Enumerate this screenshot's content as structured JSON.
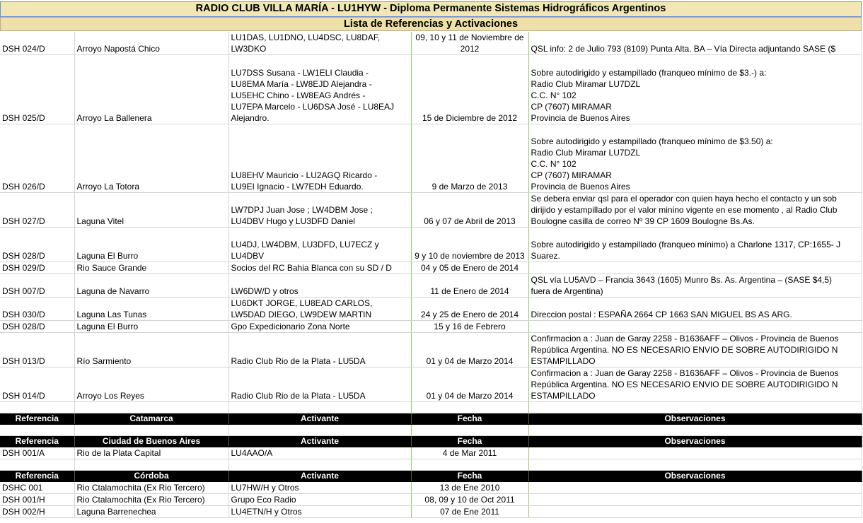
{
  "title": "RADIO CLUB VILLA MARÍA - LU1HYW - Diploma Permanente Sistemas Hidrográficos Argentinos",
  "subtitle": "Lista de Referencias y Activaciones",
  "rows_top": [
    {
      "ref": "DSH 024/D",
      "nombre": "Arroyo Napostá Chico",
      "act": [
        "LU1DAS, LU1DNO, LU4DSC, LU8DAF,",
        "LW3DKO"
      ],
      "fecha": "09, 10 y 11 de Noviembre de 2012",
      "obs": [
        "QSL info: 2 de Julio 793 (8109) Punta Alta. BA – Vía Directa adjuntando SASE ($"
      ]
    },
    {
      "ref": "DSH 025/D",
      "nombre": "Arroyo La Ballenera",
      "act": [
        "LU7DSS Susana - LW1ELI Claudia -",
        "LU8EMA María - LW8EJD Alejandra -",
        "LU5EHC Chino - LW8EAG Andrés -",
        "LU7EPA Marcelo - LU6DSA José - LU8EAJ",
        "Alejandro."
      ],
      "fecha": "15 de Diciembre de 2012",
      "obs": [
        "Sobre autodirigido y estampillado (franqueo mínimo de $3.-) a:",
        "Radio Club Miramar LU7DZL",
        "C.C. N° 102",
        "CP (7607) MIRAMAR",
        "Provincia de Buenos Aires"
      ]
    },
    {
      "ref": "DSH 026/D",
      "nombre": "Arroyo La Totora",
      "act": [
        "LU8EHV Mauricio - LU2AGQ Ricardo -",
        "LU9EI Ignacio - LW7EDH Eduardo."
      ],
      "fecha": "9 de Marzo de 2013",
      "obs": [
        "Sobre autodirigido y estampillado (franqueo mínimo de $3.50) a:",
        "Radio Club Miramar LU7DZL",
        "C.C. N° 102",
        "CP (7607) MIRAMAR",
        "Provincia de Buenos Aires"
      ]
    },
    {
      "ref": "DSH 027/D",
      "nombre": "Laguna Vitel",
      "act": [
        "LW7DPJ Juan Jose ; LW4DBM Jose ;",
        "LU4DBV Hugo y LU3DFD Daniel"
      ],
      "fecha": "06 y 07 de Abril de 2013",
      "obs": [
        "Se debera enviar qsl para el operador con quien haya hecho el contacto y un sob",
        "dirijido y estampillado por el valor minino vigente en ese momento , al Radio Club",
        "Boulogne casilla de correo Nº 39 CP 1609 Boulogne Bs.As."
      ]
    },
    {
      "ref": "DSH 028/D",
      "nombre": "Laguna El Burro",
      "act": [
        "LU4DJ, LW4DBM, LU3DFD, LU7ECZ y",
        "LU4DBV"
      ],
      "fecha": "9 y 10 de noviembre de 2013",
      "obs": [
        "Sobre autodirigido y estampillado (franqueo mínimo) a Charlone 1317, CP:1655- J",
        "Suarez."
      ]
    },
    {
      "ref": "DSH 029/D",
      "nombre": "Rio Sauce Grande",
      "act": [
        "Socios del RC Bahia Blanca con su SD / D"
      ],
      "fecha": "04 y 05 de Enero de 2014",
      "obs": []
    },
    {
      "ref": "DSH 007/D",
      "nombre": "Laguna de Navarro",
      "act": [
        "LW6DW/D y otros"
      ],
      "fecha": "11 de Enero de 2014",
      "obs": [
        "QSL vía LU5AVD – Francia 3643 (1605) Munro Bs. As. Argentina – (SASE $4,5)",
        "fuera de Argentina)"
      ]
    },
    {
      "ref": "DSH 030/D",
      "nombre": "Laguna Las Tunas",
      "act": [
        "LU6DKT JORGE, LU8EAD CARLOS,",
        "LW5DAD DIEGO, LW9DEW MARTIN"
      ],
      "fecha": "24 y 25 de Enero de 2014",
      "obs": [
        "Direccion postal : ESPAÑA 2664 CP 1663 SAN MIGUEL BS AS ARG."
      ]
    },
    {
      "ref": "DSH 028/D",
      "nombre": "Laguna El Burro",
      "act": [
        "Gpo Expedicionario Zona Norte"
      ],
      "fecha": "15 y 16 de Febrero",
      "obs": []
    },
    {
      "ref": "DSH 013/D",
      "nombre": "Río Sarmiento",
      "act": [
        "Radio Club Rio de la Plata - LU5DA"
      ],
      "fecha": "01 y 04 de Marzo 2014",
      "obs": [
        "Confirmacion a : Juan de Garay 2258 - B1636AFF – Olivos - Provincia de Buenos",
        "República Argentina. NO ES NECESARIO ENVIO DE SOBRE AUTODIRIGIDO N",
        "ESTAMPILLADO"
      ]
    },
    {
      "ref": "DSH 014/D",
      "nombre": "Arroyo Los Reyes",
      "act": [
        "Radio Club Rio de la Plata - LU5DA"
      ],
      "fecha": "01 y 04 de Marzo 2014",
      "obs": [
        "Confirmacion a : Juan de Garay 2258 - B1636AFF – Olivos - Provincia de Buenos",
        "República Argentina. NO ES NECESARIO ENVIO DE SOBRE AUTODIRIGIDO N",
        "ESTAMPILLADO"
      ]
    }
  ],
  "sections": [
    {
      "headers": [
        "Referencia",
        "Catamarca",
        "Activante",
        "Fecha",
        "Observaciones"
      ],
      "rows": []
    },
    {
      "headers": [
        "Referencia",
        "Ciudad de Buenos Aires",
        "Activante",
        "Fecha",
        "Observaciones"
      ],
      "rows": [
        {
          "ref": "DSH 001/A",
          "nombre": "Rio de la Plata Capital",
          "act": "LU4AAO/A",
          "fecha": "4 de Mar 2011",
          "obs": ""
        }
      ]
    },
    {
      "headers": [
        "Referencia",
        "Córdoba",
        "Activante",
        "Fecha",
        "Observaciones"
      ],
      "rows": [
        {
          "ref": "DSHC 001",
          "nombre": "Rio Ctalamochita (Ex Rio Tercero)",
          "act": "LU7HW/H y Otros",
          "fecha": "13 de Ene 2010",
          "obs": ""
        },
        {
          "ref": "DSH 001/H",
          "nombre": "Rio Ctalamochita (Ex Rio Tercero)",
          "act": "Grupo Eco Radio",
          "fecha": "08, 09 y 10 de Oct 2011",
          "obs": ""
        },
        {
          "ref": "DSH 002/H",
          "nombre": "Laguna Barrenechea",
          "act": "LU4ETN/H y Otros",
          "fecha": "07 de Ene 2011",
          "obs": ""
        }
      ]
    }
  ]
}
